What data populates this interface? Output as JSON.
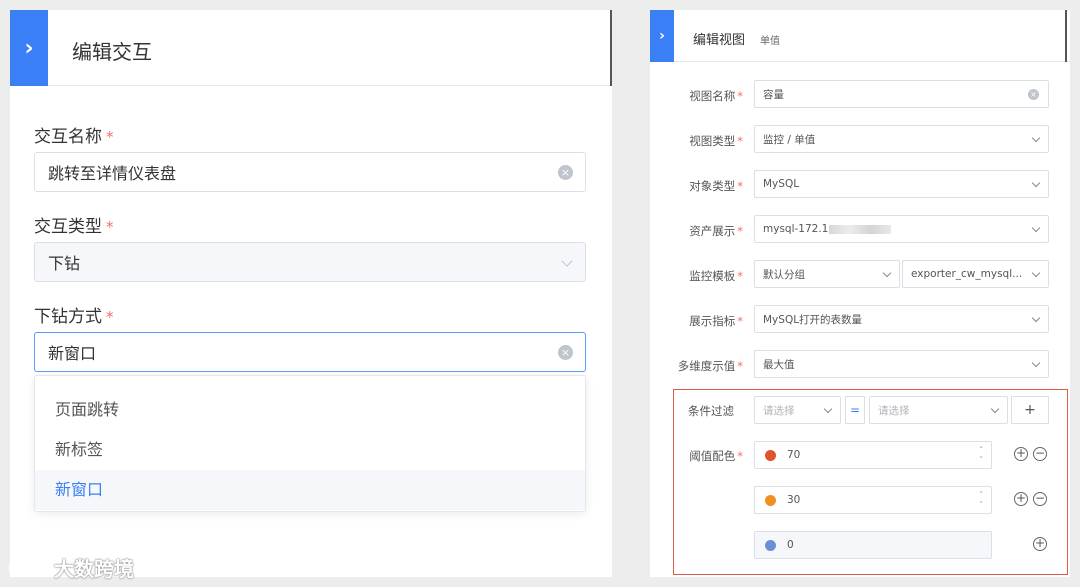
{
  "left": {
    "title": "编辑交互",
    "fields": [
      {
        "label": "交互名称",
        "value": "跳转至详情仪表盘"
      },
      {
        "label": "交互类型",
        "value": "下钻"
      },
      {
        "label": "下钻方式",
        "value": "新窗口"
      }
    ],
    "required_mark": "*",
    "dropdown_options": [
      "页面跳转",
      "新标签",
      "新窗口"
    ],
    "selected_option": "新窗口"
  },
  "right": {
    "title": "编辑视图",
    "subtitle": "单值",
    "rows": [
      {
        "label": "视图名称",
        "value": "容量"
      },
      {
        "label": "视图类型",
        "value": "监控 / 单值"
      },
      {
        "label": "对象类型",
        "value": "MySQL"
      },
      {
        "label": "资产展示",
        "value": "mysql-172.1"
      },
      {
        "label": "监控模板",
        "value": "默认分组",
        "value2": "exporter_cw_mysql..."
      },
      {
        "label": "展示指标",
        "value": "MySQL打开的表数量"
      },
      {
        "label": "多维度示值",
        "value": "最大值"
      }
    ],
    "filter": {
      "label": "条件过滤",
      "placeholder1": "请选择",
      "operator": "=",
      "placeholder2": "请选择",
      "add": "+"
    },
    "threshold": {
      "label": "阈值配色",
      "items": [
        {
          "value": "70",
          "color": "#e0532c"
        },
        {
          "value": "30",
          "color": "#f0901f"
        },
        {
          "value": "0",
          "color": "#6b8fd4"
        }
      ]
    }
  },
  "watermark": "大数跨境",
  "colors": {
    "accent": "#3a7ff5",
    "required": "#f56c6c",
    "highlight_box": "#e05a4b"
  }
}
